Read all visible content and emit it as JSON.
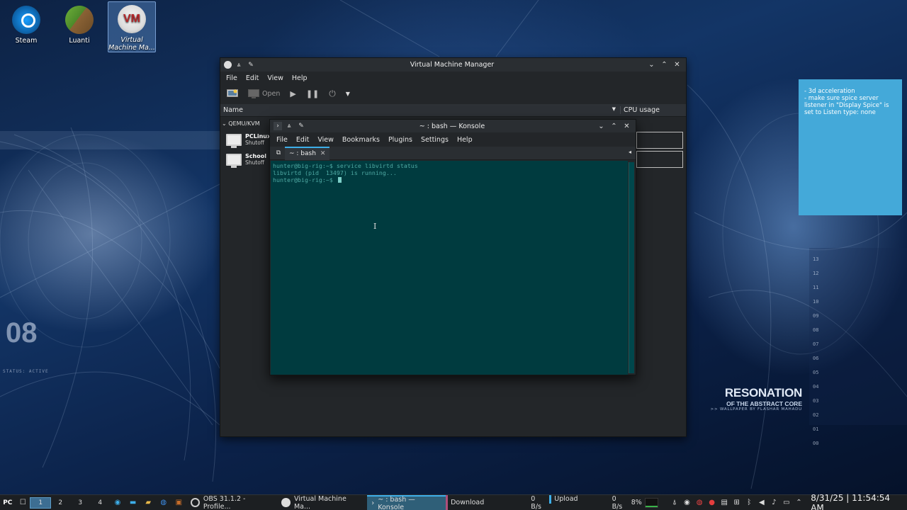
{
  "desktop": {
    "icons": [
      {
        "label": "Steam"
      },
      {
        "label": "Luanti"
      },
      {
        "label": "Virtual Machine Ma..."
      }
    ],
    "wallpaper": {
      "big_number": "08",
      "status_text": "STATUS: ACTIVE",
      "brand_title": "RESONATION",
      "brand_subtitle": "OF THE ABSTRACT CORE",
      "brand_credit": ">> WALLPAPER BY FLASHAR MAHADU",
      "ticks": [
        "13",
        "12",
        "11",
        "10",
        "09",
        "08",
        "07",
        "06",
        "05",
        "04",
        "03",
        "02",
        "01",
        "00"
      ]
    }
  },
  "note": {
    "lines": [
      "- 3d acceleration",
      "- make sure spice server listener in \"Display Spice\" is set to Listen type: none"
    ]
  },
  "vmm": {
    "title": "Virtual Machine Manager",
    "menu": [
      "File",
      "Edit",
      "View",
      "Help"
    ],
    "toolbar": {
      "open_label": "Open"
    },
    "columns": {
      "name": "Name",
      "cpu": "CPU usage"
    },
    "connection": "QEMU/KVM",
    "vms": [
      {
        "name": "PCLinux",
        "state": "Shutoff"
      },
      {
        "name": "School",
        "state": "Shutoff"
      }
    ]
  },
  "konsole": {
    "title": "~ : bash — Konsole",
    "menu": [
      "File",
      "Edit",
      "View",
      "Bookmarks",
      "Plugins",
      "Settings",
      "Help"
    ],
    "tab_label": "~ : bash",
    "terminal_lines": [
      "hunter@big-rig:~$ service libvirtd status",
      "libvirtd (pid  13497) is running...",
      "hunter@big-rig:~$ "
    ]
  },
  "taskbar": {
    "pager": [
      "1",
      "2",
      "3",
      "4"
    ],
    "tasks": [
      {
        "label": "OBS 31.1.2 - Profile..."
      },
      {
        "label": "Virtual Machine Ma..."
      },
      {
        "label": "~ : bash — Konsole"
      },
      {
        "label": "Download"
      }
    ],
    "net_down": "0 B/s",
    "net_up_label": "Upload",
    "net_up": "0 B/s",
    "cpu_percent": "8%",
    "clock": "8/31/25 | 11:54:54 AM"
  },
  "colors": {
    "accent": "#3daee9",
    "terminal_bg": "#003b3f",
    "terminal_fg": "#4ea9a3",
    "note_bg": "#44a9d9"
  }
}
